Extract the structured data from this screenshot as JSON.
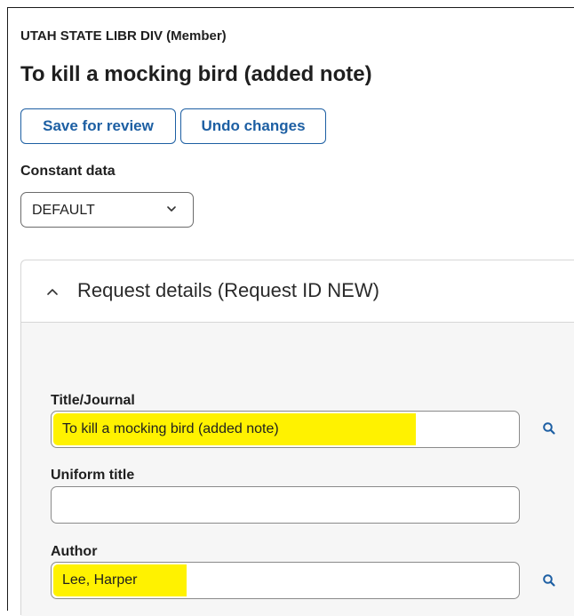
{
  "header": {
    "institution": "UTAH STATE LIBR DIV (Member)",
    "title": "To kill a mocking bird (added note)"
  },
  "actions": {
    "save_label": "Save for review",
    "undo_label": "Undo changes"
  },
  "constant_data": {
    "label": "Constant data",
    "selected": "DEFAULT"
  },
  "request_details": {
    "title": "Request details (Request ID NEW)",
    "fields": {
      "title_journal": {
        "label": "Title/Journal",
        "value": "To kill a mocking bird (added note)"
      },
      "uniform_title": {
        "label": "Uniform title",
        "value": ""
      },
      "author": {
        "label": "Author",
        "value": "Lee, Harper"
      }
    }
  },
  "colors": {
    "accent": "#1d5fa3",
    "highlight": "#fff200",
    "panel_bg": "#f6f6f6"
  },
  "icons": {
    "title_search": "search-icon",
    "author_search": "search-icon",
    "dropdown": "chevron-down-icon",
    "collapse": "chevron-up-icon"
  }
}
